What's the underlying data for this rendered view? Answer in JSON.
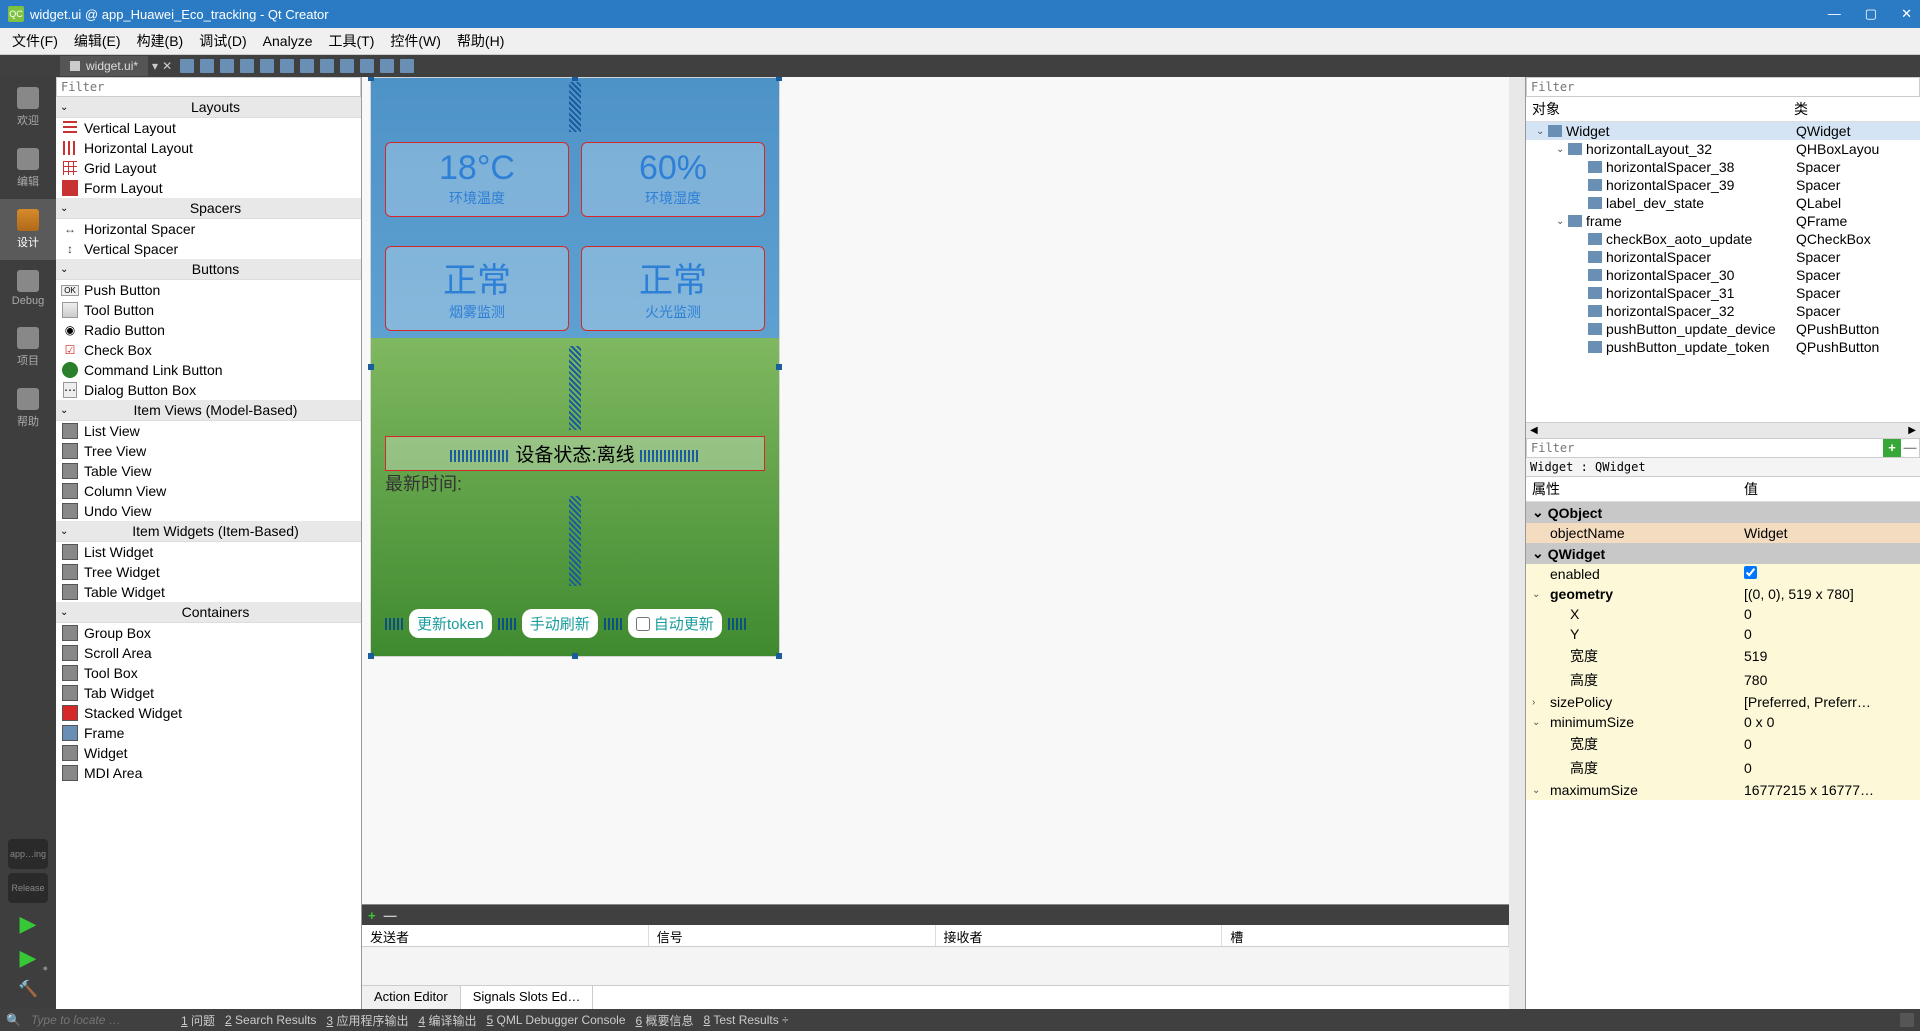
{
  "titlebar": {
    "title": "widget.ui @ app_Huawei_Eco_tracking - Qt Creator"
  },
  "menu": [
    "文件(F)",
    "编辑(E)",
    "构建(B)",
    "调试(D)",
    "Analyze",
    "工具(T)",
    "控件(W)",
    "帮助(H)"
  ],
  "tab": {
    "filename": "widget.ui*",
    "unsaved": "*"
  },
  "modes": [
    {
      "label": "欢迎"
    },
    {
      "label": "编辑"
    },
    {
      "label": "设计",
      "active": true
    },
    {
      "label": "Debug"
    },
    {
      "label": "项目"
    },
    {
      "label": "帮助"
    }
  ],
  "modeBottom": {
    "kit1": "app…ing",
    "kit2": "Release"
  },
  "widgetbox": {
    "filter_placeholder": "Filter",
    "groups": [
      {
        "title": "Layouts",
        "items": [
          "Vertical Layout",
          "Horizontal Layout",
          "Grid Layout",
          "Form Layout"
        ]
      },
      {
        "title": "Spacers",
        "items": [
          "Horizontal Spacer",
          "Vertical Spacer"
        ]
      },
      {
        "title": "Buttons",
        "items": [
          "Push Button",
          "Tool Button",
          "Radio Button",
          "Check Box",
          "Command Link Button",
          "Dialog Button Box"
        ]
      },
      {
        "title": "Item Views (Model-Based)",
        "items": [
          "List View",
          "Tree View",
          "Table View",
          "Column View",
          "Undo View"
        ]
      },
      {
        "title": "Item Widgets (Item-Based)",
        "items": [
          "List Widget",
          "Tree Widget",
          "Table Widget"
        ]
      },
      {
        "title": "Containers",
        "items": [
          "Group Box",
          "Scroll Area",
          "Tool Box",
          "Tab Widget",
          "Stacked Widget",
          "Frame",
          "Widget",
          "MDI Area"
        ]
      }
    ]
  },
  "preview": {
    "temp_value": "18°C",
    "temp_label": "环境温度",
    "humid_value": "60%",
    "humid_label": "环境湿度",
    "smoke_value": "正常",
    "smoke_label": "烟雾监测",
    "fire_value": "正常",
    "fire_label": "火光监测",
    "dev_state": "设备状态:离线",
    "latest_time": "最新时间:",
    "btn_token": "更新token",
    "btn_manual": "手动刷新",
    "auto_update": "自动更新"
  },
  "sigslot": {
    "headers": [
      "发送者",
      "信号",
      "接收者",
      "槽"
    ],
    "tabs": [
      "Action Editor",
      "Signals Slots Ed…"
    ]
  },
  "objtree": {
    "filter_placeholder": "Filter",
    "head": {
      "c1": "对象",
      "c2": "类"
    },
    "rows": [
      {
        "indent": 0,
        "chev": "⌄",
        "name": "Widget",
        "cls": "QWidget",
        "sel": true
      },
      {
        "indent": 1,
        "chev": "⌄",
        "name": "horizontalLayout_32",
        "cls": "QHBoxLayou"
      },
      {
        "indent": 2,
        "chev": "",
        "name": "horizontalSpacer_38",
        "cls": "Spacer"
      },
      {
        "indent": 2,
        "chev": "",
        "name": "horizontalSpacer_39",
        "cls": "Spacer"
      },
      {
        "indent": 2,
        "chev": "",
        "name": "label_dev_state",
        "cls": "QLabel"
      },
      {
        "indent": 1,
        "chev": "⌄",
        "name": "frame",
        "cls": "QFrame"
      },
      {
        "indent": 2,
        "chev": "",
        "name": "checkBox_aoto_update",
        "cls": "QCheckBox"
      },
      {
        "indent": 2,
        "chev": "",
        "name": "horizontalSpacer",
        "cls": "Spacer"
      },
      {
        "indent": 2,
        "chev": "",
        "name": "horizontalSpacer_30",
        "cls": "Spacer"
      },
      {
        "indent": 2,
        "chev": "",
        "name": "horizontalSpacer_31",
        "cls": "Spacer"
      },
      {
        "indent": 2,
        "chev": "",
        "name": "horizontalSpacer_32",
        "cls": "Spacer"
      },
      {
        "indent": 2,
        "chev": "",
        "name": "pushButton_update_device",
        "cls": "QPushButton"
      },
      {
        "indent": 2,
        "chev": "",
        "name": "pushButton_update_token",
        "cls": "QPushButton"
      }
    ]
  },
  "props": {
    "filter_placeholder": "Filter",
    "context": "Widget : QWidget",
    "head": {
      "c1": "属性",
      "c2": "值"
    },
    "groups": {
      "qobject": "QObject",
      "qwidget": "QWidget"
    },
    "rows": {
      "objectName": {
        "name": "objectName",
        "val": "Widget"
      },
      "enabled": {
        "name": "enabled",
        "val": true
      },
      "geometry": {
        "name": "geometry",
        "val": "[(0, 0), 519 x 780]"
      },
      "x": {
        "name": "X",
        "val": "0"
      },
      "y": {
        "name": "Y",
        "val": "0"
      },
      "w": {
        "name": "宽度",
        "val": "519"
      },
      "h": {
        "name": "高度",
        "val": "780"
      },
      "sizePolicy": {
        "name": "sizePolicy",
        "val": "[Preferred, Preferr…"
      },
      "minimumSize": {
        "name": "minimumSize",
        "val": "0 x 0"
      },
      "minw": {
        "name": "宽度",
        "val": "0"
      },
      "minh": {
        "name": "高度",
        "val": "0"
      },
      "maximumSize": {
        "name": "maximumSize",
        "val": "16777215 x 16777…"
      }
    }
  },
  "statusbar": {
    "locate_placeholder": "Type to locate …",
    "items": [
      {
        "n": "1",
        "label": "问题"
      },
      {
        "n": "2",
        "label": "Search Results"
      },
      {
        "n": "3",
        "label": "应用程序输出"
      },
      {
        "n": "4",
        "label": "编译输出"
      },
      {
        "n": "5",
        "label": "QML Debugger Console"
      },
      {
        "n": "6",
        "label": "概要信息"
      },
      {
        "n": "8",
        "label": "Test Results"
      }
    ]
  }
}
